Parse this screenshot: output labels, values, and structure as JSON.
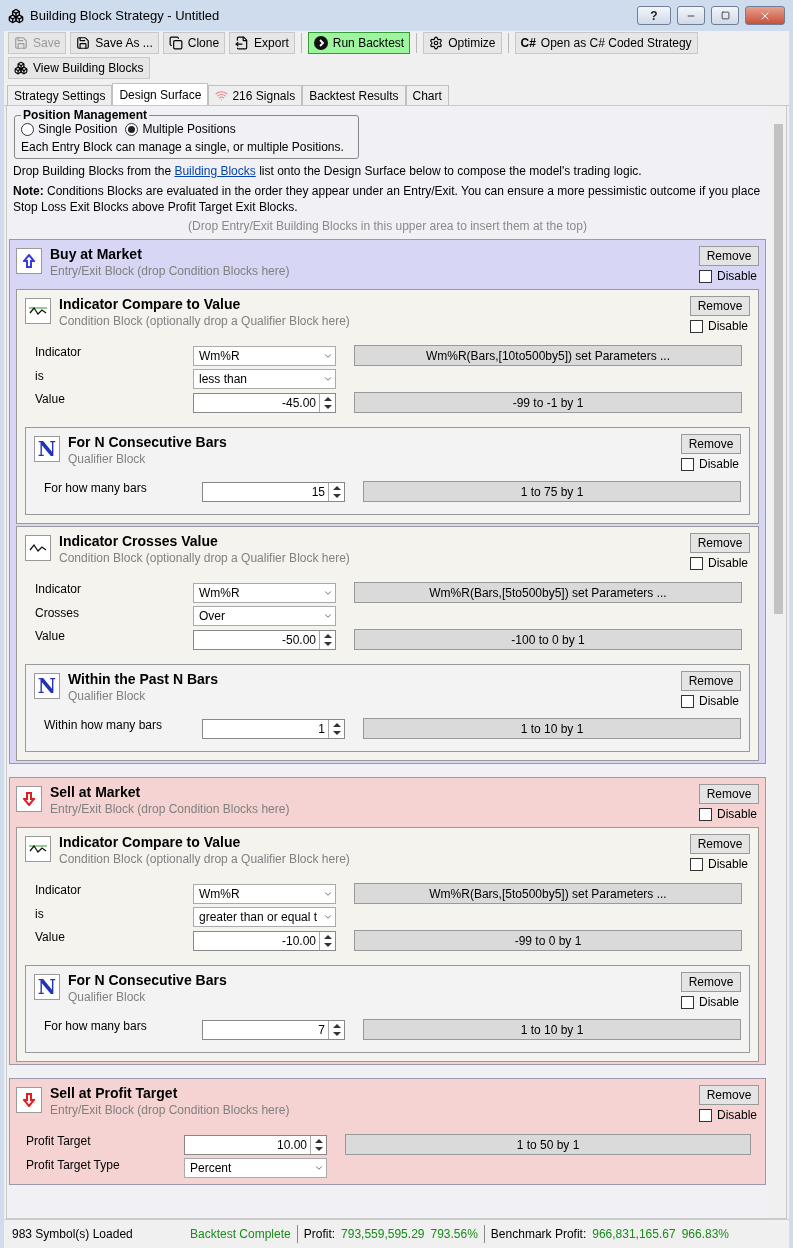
{
  "window": {
    "title": "Building Block Strategy - Untitled",
    "help": "?"
  },
  "toolbar_rows": [
    [
      [
        {
          "label": "Save",
          "disabled": true
        },
        {
          "label": "Save As ...",
          "disabled": false
        },
        {
          "label": "Clone",
          "disabled": false
        },
        {
          "label": "Export",
          "disabled": false
        }
      ],
      [
        {
          "label": "Run Backtest",
          "disabled": false
        }
      ],
      [
        {
          "label": "Optimize",
          "disabled": false
        }
      ],
      [
        {
          "label": "Open as C# Coded Strategy",
          "icon_text": "C#",
          "disabled": false
        }
      ]
    ],
    [
      [
        {
          "label": "View Building Blocks",
          "disabled": false
        }
      ]
    ]
  ],
  "tabs": [
    {
      "label": "Strategy Settings",
      "selected": false
    },
    {
      "label": "Design Surface",
      "selected": true
    },
    {
      "label": "216 Signals",
      "selected": false
    },
    {
      "label": "Backtest Results",
      "selected": false
    },
    {
      "label": "Chart",
      "selected": false
    }
  ],
  "position_management": {
    "title": "Position Management",
    "options": [
      {
        "label": "Single Position",
        "selected": false
      },
      {
        "label": "Multiple Positions",
        "selected": true
      }
    ],
    "note": "Each Entry Block can manage a single, or multiple Positions."
  },
  "intro": {
    "before": "Drop Building Blocks from the",
    "link": "Building Blocks",
    "after": "list onto the Design Surface below to compose the model's trading logic."
  },
  "note": "**Note:** Conditions Blocks are evaluated in the order they appear under an Entry/Exit. You can ensure a more pessimistic outcome if you place Stop Loss Exit Blocks above Profit Target Exit Blocks.",
  "drop_hint": "(Drop Entry/Exit Building Blocks in this upper area to insert them at the top)",
  "blocks": [
    {
      "kind": "buy",
      "title": "Buy at Market",
      "subtitle": "Entry/Exit Block (drop Condition Blocks here)",
      "remove": "Remove",
      "disable": {
        "label": "Disable",
        "checked": false
      },
      "conditions": [
        {
          "kind": "compare",
          "title": "Indicator Compare to Value",
          "subtitle": "Condition Block (optionally drop a Qualifier Block here)",
          "remove": "Remove",
          "disable": {
            "label": "Disable",
            "checked": false
          },
          "params": [
            {
              "label": "Indicator",
              "kind": "dropdown",
              "value": "Wm%R",
              "info": "Wm%R(Bars,[10to500by5]) set Parameters ..."
            },
            {
              "label": "is",
              "kind": "dropdown",
              "value": "less than"
            },
            {
              "label": "Value",
              "kind": "number",
              "value": "-45.00",
              "info": "-99 to -1 by 1"
            }
          ],
          "qualifiers": [
            {
              "badge": "N",
              "title": "For N Consecutive Bars",
              "subtitle": "Qualifier Block",
              "remove": "Remove",
              "disable": {
                "label": "Disable",
                "checked": false
              },
              "params": [
                {
                  "label": "For how many bars",
                  "kind": "number",
                  "value": "15",
                  "info": "1 to 75 by 1"
                }
              ]
            }
          ]
        },
        {
          "kind": "crosses",
          "title": "Indicator Crosses Value",
          "subtitle": "Condition Block (optionally drop a Qualifier Block here)",
          "remove": "Remove",
          "disable": {
            "label": "Disable",
            "checked": false
          },
          "params": [
            {
              "label": "Indicator",
              "kind": "dropdown",
              "value": "Wm%R",
              "info": "Wm%R(Bars,[5to500by5]) set Parameters ..."
            },
            {
              "label": "Crosses",
              "kind": "dropdown",
              "value": "Over"
            },
            {
              "label": "Value",
              "kind": "number",
              "value": "-50.00",
              "info": "-100 to 0 by 1"
            }
          ],
          "qualifiers": [
            {
              "badge": "N",
              "title": "Within the Past N Bars",
              "subtitle": "Qualifier Block",
              "remove": "Remove",
              "disable": {
                "label": "Disable",
                "checked": false
              },
              "params": [
                {
                  "label": "Within how many bars",
                  "kind": "number",
                  "value": "1",
                  "info": "1 to 10 by 1"
                }
              ]
            }
          ]
        }
      ]
    },
    {
      "kind": "sell",
      "title": "Sell at Market",
      "subtitle": "Entry/Exit Block (drop Condition Blocks here)",
      "remove": "Remove",
      "disable": {
        "label": "Disable",
        "checked": false
      },
      "conditions": [
        {
          "kind": "compare",
          "title": "Indicator Compare to Value",
          "subtitle": "Condition Block (optionally drop a Qualifier Block here)",
          "remove": "Remove",
          "disable": {
            "label": "Disable",
            "checked": false
          },
          "params": [
            {
              "label": "Indicator",
              "kind": "dropdown",
              "value": "Wm%R",
              "info": "Wm%R(Bars,[5to500by5]) set Parameters ..."
            },
            {
              "label": "is",
              "kind": "dropdown",
              "value": "greater than or equal t"
            },
            {
              "label": "Value",
              "kind": "number",
              "value": "-10.00",
              "info": "-99 to 0 by 1"
            }
          ],
          "qualifiers": [
            {
              "badge": "N",
              "title": "For N Consecutive Bars",
              "subtitle": "Qualifier Block",
              "remove": "Remove",
              "disable": {
                "label": "Disable",
                "checked": false
              },
              "params": [
                {
                  "label": "For how many bars",
                  "kind": "number",
                  "value": "7",
                  "info": "1 to 10 by 1"
                }
              ]
            }
          ]
        }
      ]
    },
    {
      "kind": "sell",
      "title": "Sell at Profit Target",
      "subtitle": "Entry/Exit Block (drop Condition Blocks here)",
      "remove": "Remove",
      "disable": {
        "label": "Disable",
        "checked": false
      },
      "params": [
        {
          "label": "Profit Target",
          "kind": "number",
          "value": "10.00",
          "info": "1 to 50 by 1"
        },
        {
          "label": "Profit Target Type",
          "kind": "dropdown",
          "value": "Percent"
        }
      ]
    }
  ],
  "status_bar": {
    "symbols": "983 Symbol(s) Loaded",
    "state": "Backtest Complete",
    "profit_label": "Profit:",
    "profit": "793,559,595.29",
    "profit_pct": "793.56%",
    "benchmark_label": "Benchmark Profit:",
    "benchmark": "966,831,165.67",
    "benchmark_pct": "966.83%"
  }
}
